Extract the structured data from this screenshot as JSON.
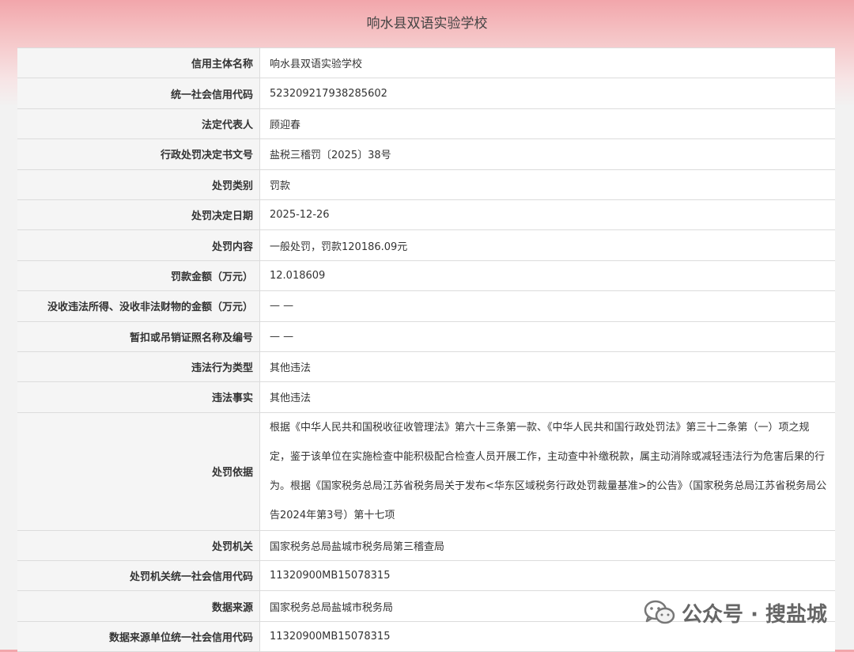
{
  "header": {
    "title": "响水县双语实验学校"
  },
  "rows": [
    {
      "key": "信用主体名称",
      "value": "响水县双语实验学校"
    },
    {
      "key": "统一社会信用代码",
      "value": "523209217938285602"
    },
    {
      "key": "法定代表人",
      "value": "顾迎春"
    },
    {
      "key": "行政处罚决定书文号",
      "value": "盐税三稽罚〔2025〕38号"
    },
    {
      "key": "处罚类别",
      "value": "罚款"
    },
    {
      "key": "处罚决定日期",
      "value": "2025-12-26"
    },
    {
      "key": "处罚内容",
      "value": "一般处罚，罚款120186.09元"
    },
    {
      "key": "罚款金额（万元）",
      "value": "12.018609"
    },
    {
      "key": "没收违法所得、没收非法财物的金额（万元）",
      "value": "— —"
    },
    {
      "key": "暂扣或吊销证照名称及编号",
      "value": "— —"
    },
    {
      "key": "违法行为类型",
      "value": "其他违法"
    },
    {
      "key": "违法事实",
      "value": "其他违法"
    },
    {
      "key": "处罚依据",
      "value": "根据《中华人民共和国税收征收管理法》第六十三条第一款、《中华人民共和国行政处罚法》第三十二条第（一）项之规定，鉴于该单位在实施检查中能积极配合检查人员开展工作，主动查中补缴税款，属主动消除或减轻违法行为危害后果的行为。根据《国家税务总局江苏省税务局关于发布<华东区域税务行政处罚裁量基准>的公告》（国家税务总局江苏省税务局公告2024年第3号）第十七项"
    },
    {
      "key": "处罚机关",
      "value": "国家税务总局盐城市税务局第三稽查局"
    },
    {
      "key": "处罚机关统一社会信用代码",
      "value": "11320900MB15078315"
    },
    {
      "key": "数据来源",
      "value": "国家税务总局盐城市税务局"
    },
    {
      "key": "数据来源单位统一社会信用代码",
      "value": "11320900MB15078315"
    }
  ],
  "watermark": {
    "text": "公众号 · 搜盐城",
    "icon": "wechat-icon"
  }
}
